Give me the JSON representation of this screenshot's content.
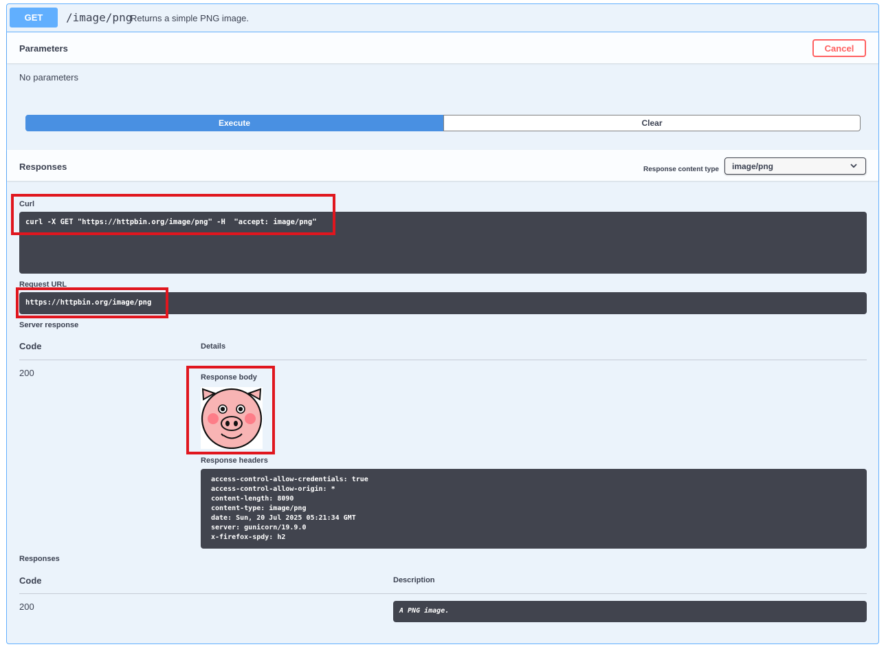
{
  "operation": {
    "method": "GET",
    "path": "/image/png",
    "summary": "Returns a simple PNG image."
  },
  "parameters": {
    "title": "Parameters",
    "cancel_label": "Cancel",
    "empty_text": "No parameters"
  },
  "actions": {
    "execute_label": "Execute",
    "clear_label": "Clear"
  },
  "responses_header": {
    "title": "Responses",
    "content_type_label": "Response content type",
    "content_type_value": "image/png"
  },
  "live": {
    "curl_label": "Curl",
    "curl_command": "curl -X GET \"https://httpbin.org/image/png\" -H  \"accept: image/png\"",
    "request_url_label": "Request URL",
    "request_url": "https://httpbin.org/image/png",
    "server_response_label": "Server response",
    "code_header": "Code",
    "details_header": "Details",
    "code": "200",
    "response_body_label": "Response body",
    "response_headers_label": "Response headers",
    "headers": [
      "access-control-allow-credentials: true",
      "access-control-allow-origin: *",
      "content-length: 8090",
      "content-type: image/png",
      "date: Sun, 20 Jul 2025 05:21:34 GMT",
      "server: gunicorn/19.9.0",
      "x-firefox-spdy: h2"
    ]
  },
  "documented": {
    "title": "Responses",
    "code_header": "Code",
    "description_header": "Description",
    "code": "200",
    "description": "A PNG image."
  },
  "colors": {
    "get_blue": "#61affe",
    "execute_blue": "#4990e2",
    "highlight_red": "#e0161e",
    "code_bg": "#41444e"
  }
}
